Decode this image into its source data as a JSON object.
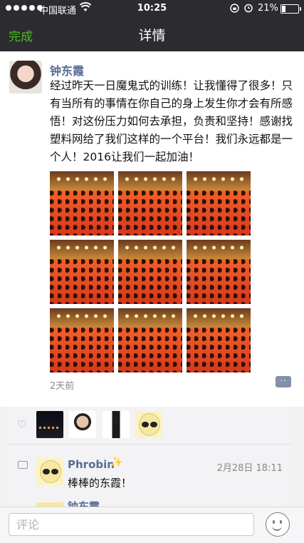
{
  "status_bar": {
    "carrier": "中国联通",
    "time": "10:25",
    "battery": "21%"
  },
  "nav": {
    "back_label": "完成",
    "title": "详情"
  },
  "post": {
    "author": "钟东霞",
    "text": "经过昨天一日魔鬼式的训练！让我懂得了很多！只有当所有的事情在你自己的身上发生你才会有所感悟！对这份压力如何去承担，负责和坚持！感谢找塑料网给了我们这样的一个平台！我们永远都是一个人！2016让我们一起加油！",
    "photo_count": 9,
    "time_ago": "2天前",
    "comment_button": "··"
  },
  "likes": {
    "icon": "heart-icon",
    "avatar_count": 4
  },
  "comments": [
    {
      "author": "Phrobin",
      "decoration": "✨",
      "time": "2月28日  18:11",
      "text": "棒棒的东霞！"
    },
    {
      "author": "钟东霞"
    }
  ],
  "input": {
    "placeholder": "评论"
  },
  "colors": {
    "nav_bg": "#2b2b30",
    "done_green": "#45c01a",
    "name_blue": "#576b95"
  }
}
